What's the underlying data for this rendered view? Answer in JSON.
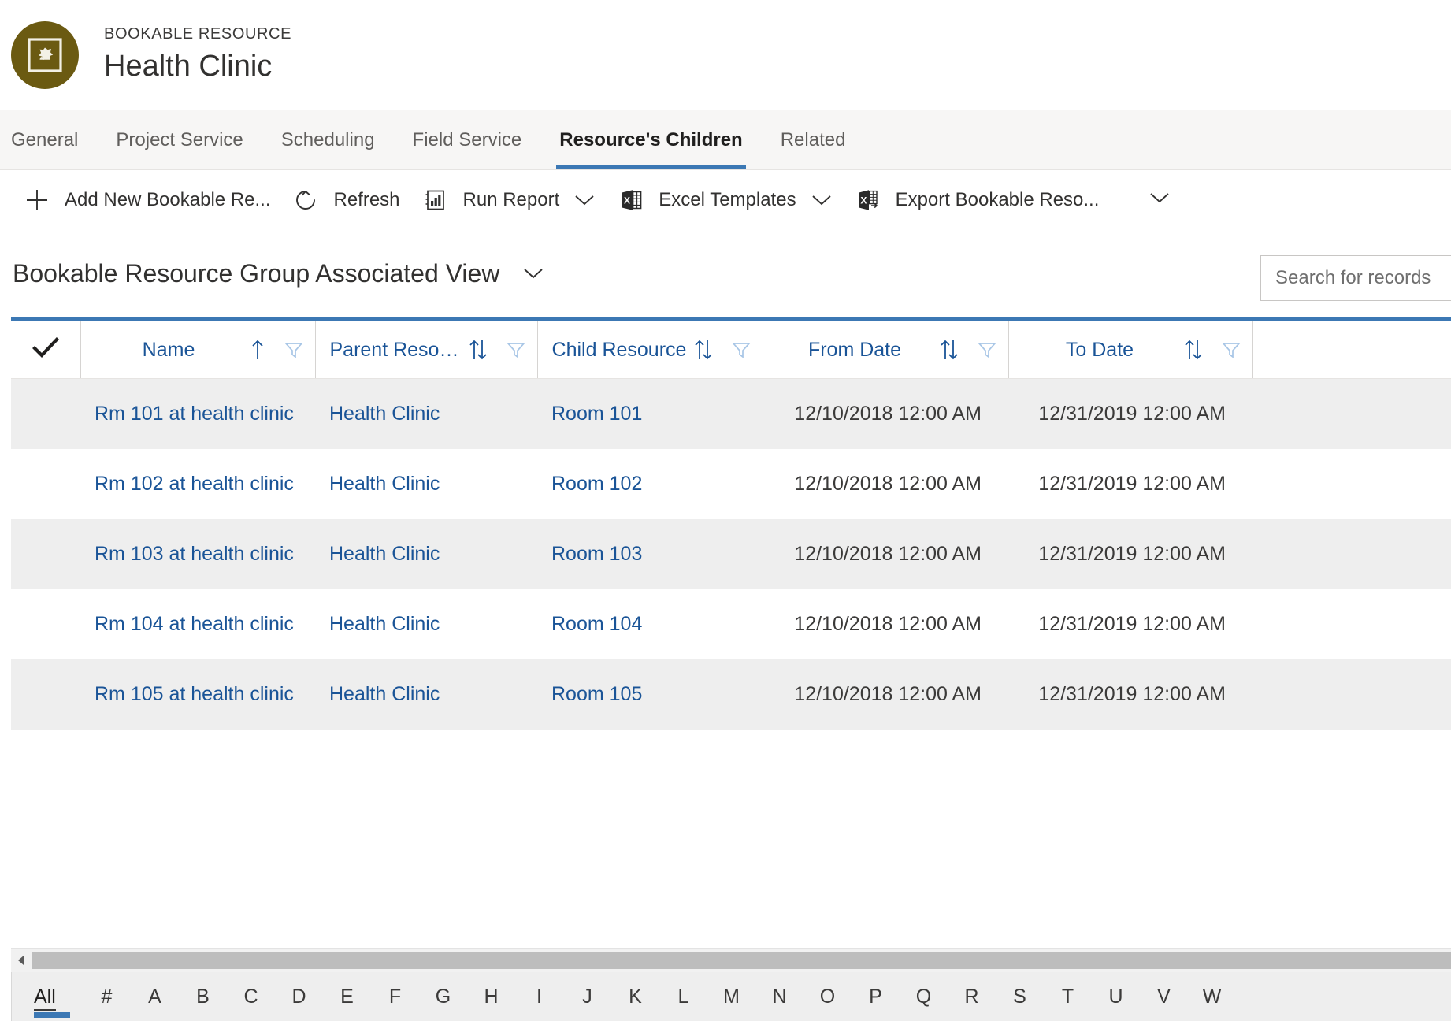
{
  "record": {
    "kicker": "BOOKABLE RESOURCE",
    "title": "Health Clinic",
    "avatar_color": "#6b5a12",
    "avatar_icon": "bookable-resource-icon"
  },
  "tabs": [
    {
      "label": "General",
      "active": false
    },
    {
      "label": "Project Service",
      "active": false
    },
    {
      "label": "Scheduling",
      "active": false
    },
    {
      "label": "Field Service",
      "active": false
    },
    {
      "label": "Resource's Children",
      "active": true
    },
    {
      "label": "Related",
      "active": false
    }
  ],
  "commandbar": {
    "items": [
      {
        "label": "Add New Bookable Re...",
        "icon": "plus-icon",
        "chevron": false
      },
      {
        "label": "Refresh",
        "icon": "refresh-icon",
        "chevron": false
      },
      {
        "label": "Run Report",
        "icon": "report-icon",
        "chevron": true
      },
      {
        "label": "Excel Templates",
        "icon": "excel-icon",
        "chevron": true
      },
      {
        "label": "Export Bookable Reso...",
        "icon": "excel-export-icon",
        "chevron": false
      }
    ],
    "overflow_icon": "chevron-down-icon"
  },
  "view": {
    "title": "Bookable Resource Group Associated View",
    "selector_icon": "chevron-down-icon"
  },
  "search": {
    "placeholder": "Search for records",
    "value": ""
  },
  "grid": {
    "accent_color": "#3c78b4",
    "link_color": "#1a5497",
    "select_all_icon": "checkmark-icon",
    "columns": [
      {
        "label": "Name",
        "sort": "asc",
        "filter": true
      },
      {
        "label": "Parent Resour...",
        "sort": "none",
        "filter": true
      },
      {
        "label": "Child Resource",
        "sort": "none",
        "filter": true
      },
      {
        "label": "From Date",
        "sort": "none",
        "filter": true
      },
      {
        "label": "To Date",
        "sort": "none",
        "filter": true
      }
    ],
    "rows": [
      {
        "name": "Rm 101 at health clinic",
        "parent": "Health Clinic",
        "child": "Room 101",
        "from": "12/10/2018 12:00 AM",
        "to": "12/31/2019 12:00 AM"
      },
      {
        "name": "Rm 102 at health clinic",
        "parent": "Health Clinic",
        "child": "Room 102",
        "from": "12/10/2018 12:00 AM",
        "to": "12/31/2019 12:00 AM"
      },
      {
        "name": "Rm 103 at health clinic",
        "parent": "Health Clinic",
        "child": "Room 103",
        "from": "12/10/2018 12:00 AM",
        "to": "12/31/2019 12:00 AM"
      },
      {
        "name": "Rm 104 at health clinic",
        "parent": "Health Clinic",
        "child": "Room 104",
        "from": "12/10/2018 12:00 AM",
        "to": "12/31/2019 12:00 AM"
      },
      {
        "name": "Rm 105 at health clinic",
        "parent": "Health Clinic",
        "child": "Room 105",
        "from": "12/10/2018 12:00 AM",
        "to": "12/31/2019 12:00 AM"
      }
    ]
  },
  "alphabet": {
    "items": [
      "All",
      "#",
      "A",
      "B",
      "C",
      "D",
      "E",
      "F",
      "G",
      "H",
      "I",
      "J",
      "K",
      "L",
      "M",
      "N",
      "O",
      "P",
      "Q",
      "R",
      "S",
      "T",
      "U",
      "V",
      "W"
    ],
    "active": "All"
  }
}
